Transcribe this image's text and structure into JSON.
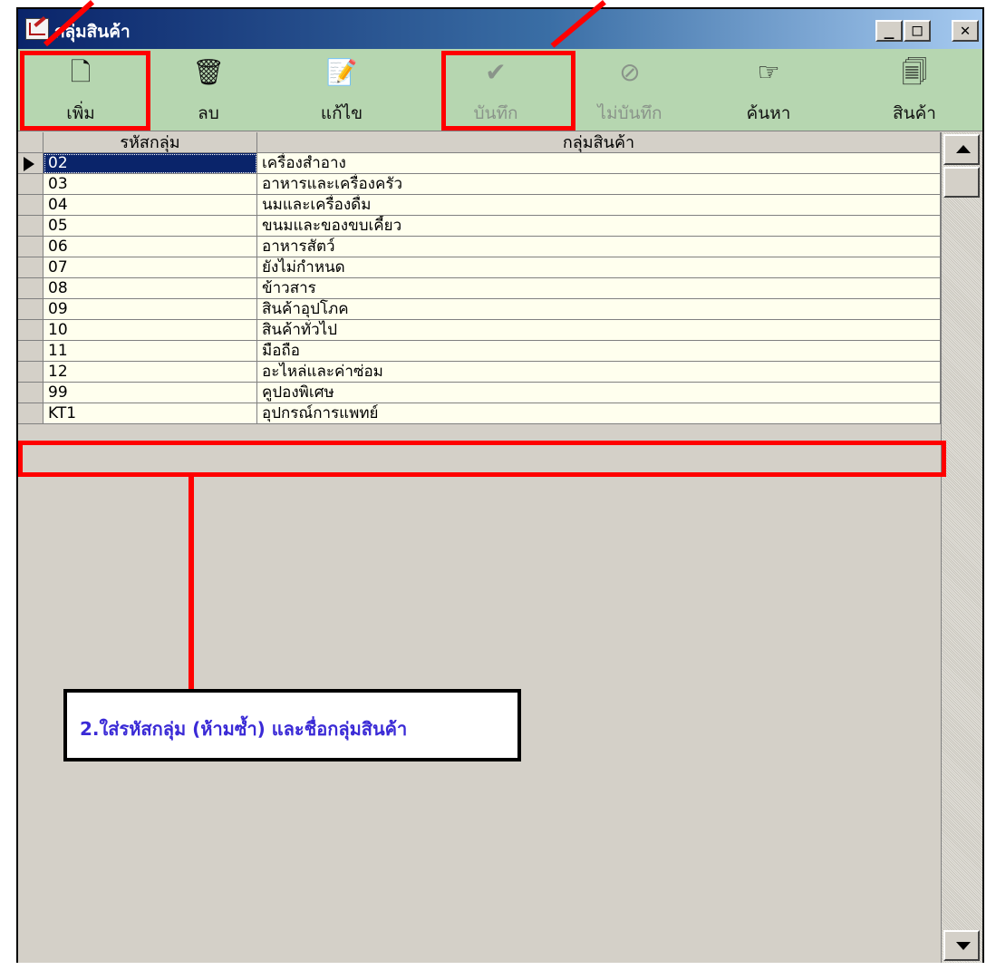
{
  "window": {
    "title": "กลุ่มสินค้า",
    "app_icon": "edit-form-icon",
    "controls": {
      "minimize": "_",
      "maximize": "□",
      "close": "✕"
    }
  },
  "toolbar": {
    "buttons": [
      {
        "label": "เพิ่ม",
        "icon": "new-document-icon",
        "glyph": "🗋",
        "enabled": true
      },
      {
        "label": "ลบ",
        "icon": "trash-icon",
        "glyph": "🗑",
        "enabled": true
      },
      {
        "label": "แก้ไข",
        "icon": "edit-document-icon",
        "glyph": "📝",
        "enabled": true
      },
      {
        "label": "บันทึก",
        "icon": "checkmark-icon",
        "glyph": "✔",
        "enabled": false
      },
      {
        "label": "ไม่บันทึก",
        "icon": "cancel-circle-icon",
        "glyph": "⊘",
        "enabled": false
      },
      {
        "label": "ค้นหา",
        "icon": "pointing-hand-icon",
        "glyph": "☞",
        "enabled": true
      },
      {
        "label": "สินค้า",
        "icon": "product-stack-icon",
        "glyph": "🗐",
        "enabled": true
      }
    ]
  },
  "grid": {
    "columns": [
      "รหัสกลุ่ม",
      "กลุ่มสินค้า"
    ],
    "rows": [
      {
        "code": "02",
        "name": "เครื่องสำอาง"
      },
      {
        "code": "03",
        "name": "อาหารและเครื่องครัว"
      },
      {
        "code": "04",
        "name": "นมและเครื่องดื่ม"
      },
      {
        "code": "05",
        "name": "ขนมและของขบเคี้ยว"
      },
      {
        "code": "06",
        "name": "อาหารสัตว์"
      },
      {
        "code": "07",
        "name": "ยังไม่กำหนด"
      },
      {
        "code": "08",
        "name": "ข้าวสาร"
      },
      {
        "code": "09",
        "name": "สินค้าอุปโภค"
      },
      {
        "code": "10",
        "name": "สินค้าทั่วไป"
      },
      {
        "code": "11",
        "name": "มือถือ"
      },
      {
        "code": "12",
        "name": "อะไหล่และค่าซ่อม"
      },
      {
        "code": "99",
        "name": "คูปองพิเศษ"
      },
      {
        "code": "KT1",
        "name": "อุปกรณ์การแพทย์"
      }
    ],
    "selected_row": 0
  },
  "annotation": {
    "callout_text": "2.ใส่รหัสกลุ่ม (ห้ามซ้ำ) และชื่อกลุ่มสินค้า",
    "highlight_color": "#ff0000",
    "text_color": "#3a2ad6"
  },
  "colors": {
    "titlebar_start": "#0a246a",
    "toolbar_bg": "#b6d6b0",
    "cell_bg": "#ffffee",
    "selected_bg": "#0a246a"
  }
}
